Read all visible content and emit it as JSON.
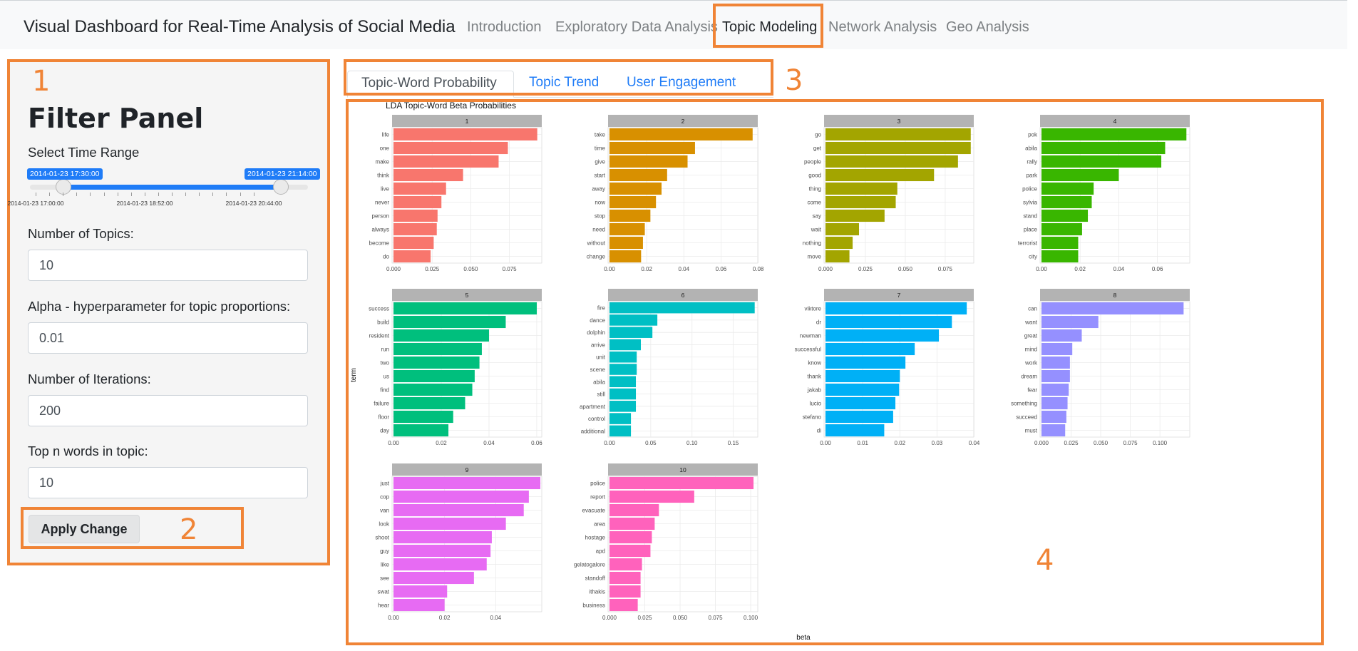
{
  "navbar": {
    "brand": "Visual Dashboard for Real-Time Analysis of Social Media",
    "links": [
      "Introduction",
      "Exploratory Data Analysis",
      "Topic Modeling",
      "Network Analysis",
      "Geo Analysis"
    ],
    "active": "Topic Modeling"
  },
  "sidebar": {
    "title": "Filter Panel",
    "time_range_label": "Select Time Range",
    "slider": {
      "from": "2014-01-23 17:30:00",
      "to": "2014-01-23 21:14:00",
      "tick_labels": [
        "2014-01-23 17:00:00",
        "2014-01-23 18:52:00",
        "2014-01-23 20:44:00"
      ]
    },
    "topics_label": "Number of Topics:",
    "topics_value": "10",
    "alpha_label": "Alpha - hyperparameter for topic proportions:",
    "alpha_value": "0.01",
    "iterations_label": "Number of Iterations:",
    "iterations_value": "200",
    "topn_label": "Top n words in topic:",
    "topn_value": "10",
    "apply_label": "Apply Change"
  },
  "tabs": [
    "Topic-Word Probability",
    "Topic Trend",
    "User Engagement"
  ],
  "annotations": [
    "1",
    "2",
    "3",
    "4"
  ],
  "colors": {
    "annotation": "#f08436",
    "link": "#1f7cf7",
    "strip": "#b3b3b3"
  },
  "chart_data": {
    "type": "bar",
    "title": "LDA Topic-Word Beta Probabilities",
    "xlabel": "beta",
    "ylabel": "term",
    "orientation": "horizontal",
    "facets": [
      {
        "name": "1",
        "color": "#f8766d",
        "xmax": 0.095,
        "ticks": [
          "0.000",
          "0.025",
          "0.050",
          "0.075"
        ],
        "terms": [
          "life",
          "one",
          "make",
          "think",
          "live",
          "never",
          "person",
          "always",
          "become",
          "do"
        ],
        "values": [
          0.093,
          0.074,
          0.068,
          0.045,
          0.034,
          0.031,
          0.0285,
          0.028,
          0.026,
          0.024
        ]
      },
      {
        "name": "2",
        "color": "#d89000",
        "xmax": 0.079,
        "ticks": [
          "0.00",
          "0.02",
          "0.04",
          "0.06",
          "0.08"
        ],
        "terms": [
          "take",
          "time",
          "give",
          "start",
          "away",
          "now",
          "stop",
          "need",
          "without",
          "change"
        ],
        "values": [
          0.077,
          0.046,
          0.042,
          0.031,
          0.028,
          0.025,
          0.022,
          0.019,
          0.018,
          0.017
        ]
      },
      {
        "name": "3",
        "color": "#a3a500",
        "xmax": 0.092,
        "ticks": [
          "0.000",
          "0.025",
          "0.050",
          "0.075"
        ],
        "terms": [
          "go",
          "get",
          "people",
          "good",
          "thing",
          "come",
          "say",
          "wait",
          "nothing",
          "move"
        ],
        "values": [
          0.091,
          0.091,
          0.083,
          0.068,
          0.045,
          0.044,
          0.037,
          0.021,
          0.017,
          0.015
        ]
      },
      {
        "name": "4",
        "color": "#39b600",
        "xmax": 0.076,
        "ticks": [
          "0.00",
          "0.02",
          "0.04",
          "0.06"
        ],
        "terms": [
          "pok",
          "abila",
          "rally",
          "park",
          "police",
          "sylvia",
          "stand",
          "place",
          "terrorist",
          "city"
        ],
        "values": [
          0.075,
          0.064,
          0.062,
          0.04,
          0.027,
          0.026,
          0.024,
          0.021,
          0.019,
          0.019
        ]
      },
      {
        "name": "5",
        "color": "#00bf7d",
        "xmax": 0.0615,
        "ticks": [
          "0.00",
          "0.02",
          "0.04",
          "0.06"
        ],
        "terms": [
          "success",
          "build",
          "resident",
          "run",
          "two",
          "us",
          "find",
          "failure",
          "floor",
          "day"
        ],
        "values": [
          0.06,
          0.047,
          0.04,
          0.037,
          0.036,
          0.034,
          0.033,
          0.03,
          0.025,
          0.023
        ]
      },
      {
        "name": "6",
        "color": "#00bfc4",
        "xmax": 0.178,
        "ticks": [
          "0.00",
          "0.05",
          "0.10",
          "0.15"
        ],
        "terms": [
          "fire",
          "dance",
          "dolphin",
          "arrive",
          "unit",
          "scene",
          "abila",
          "still",
          "apartment",
          "control",
          "additional"
        ],
        "values": [
          0.176,
          0.058,
          0.052,
          0.038,
          0.033,
          0.033,
          0.032,
          0.032,
          0.032,
          0.026,
          0.026
        ]
      },
      {
        "name": "7",
        "color": "#00b0f6",
        "xmax": 0.0395,
        "ticks": [
          "0.00",
          "0.01",
          "0.02",
          "0.03",
          "0.04"
        ],
        "terms": [
          "viktore",
          "dr",
          "newman",
          "successful",
          "know",
          "thank",
          "jakab",
          "lucio",
          "stefano",
          "di"
        ],
        "values": [
          0.038,
          0.034,
          0.0305,
          0.024,
          0.0215,
          0.02,
          0.0198,
          0.0188,
          0.0182,
          0.0158
        ]
      },
      {
        "name": "8",
        "color": "#9590ff",
        "xmax": 0.124,
        "ticks": [
          "0.000",
          "0.025",
          "0.050",
          "0.075",
          "0.100"
        ],
        "terms": [
          "can",
          "want",
          "great",
          "mind",
          "work",
          "dream",
          "fear",
          "something",
          "succeed",
          "must"
        ],
        "values": [
          0.12,
          0.048,
          0.034,
          0.026,
          0.024,
          0.024,
          0.023,
          0.022,
          0.021,
          0.02
        ]
      },
      {
        "name": "9",
        "color": "#e76bf3",
        "xmax": 0.0575,
        "ticks": [
          "0.00",
          "0.02",
          "0.04"
        ],
        "terms": [
          "just",
          "cop",
          "van",
          "look",
          "shoot",
          "guy",
          "like",
          "see",
          "swat",
          "hear"
        ],
        "values": [
          0.0575,
          0.053,
          0.051,
          0.044,
          0.0385,
          0.038,
          0.0365,
          0.0315,
          0.021,
          0.02
        ]
      },
      {
        "name": "10",
        "color": "#ff62bc",
        "xmax": 0.104,
        "ticks": [
          "0.000",
          "0.025",
          "0.050",
          "0.075",
          "0.100"
        ],
        "terms": [
          "police",
          "report",
          "evacuate",
          "area",
          "hostage",
          "apd",
          "gelatogalore",
          "standoff",
          "ithakis",
          "business"
        ],
        "values": [
          0.102,
          0.06,
          0.035,
          0.032,
          0.03,
          0.029,
          0.023,
          0.022,
          0.022,
          0.02
        ]
      }
    ]
  }
}
